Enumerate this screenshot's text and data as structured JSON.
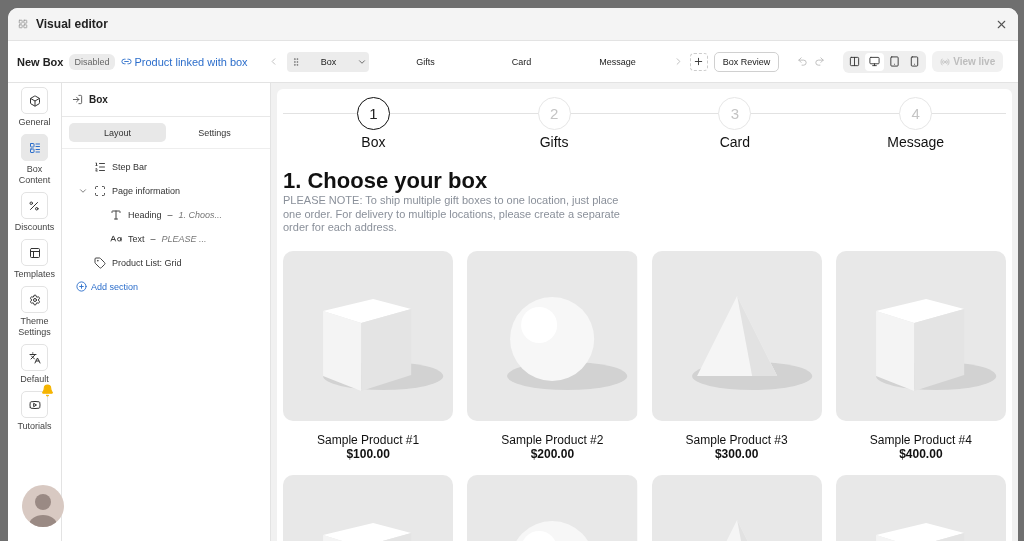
{
  "window": {
    "title": "Visual editor"
  },
  "toolbar": {
    "box_name": "New Box",
    "status": "Disabled",
    "link": "Product linked with box",
    "steps": [
      {
        "label": "Box",
        "selected": true
      },
      {
        "label": "Gifts",
        "selected": false
      },
      {
        "label": "Card",
        "selected": false
      },
      {
        "label": "Message",
        "selected": false
      }
    ],
    "review_button": "Box Review",
    "devices": [
      {
        "kind": "fullwidth",
        "selected": false
      },
      {
        "kind": "desktop",
        "selected": true
      },
      {
        "kind": "tablet",
        "selected": false
      },
      {
        "kind": "mobile",
        "selected": false
      }
    ],
    "view_live": {
      "label": "View live",
      "disabled": true
    }
  },
  "rail": [
    {
      "label": "General",
      "kind": "cube",
      "selected": false,
      "badge": false
    },
    {
      "label": "Box Content",
      "kind": "content",
      "selected": true,
      "badge": false
    },
    {
      "label": "Discounts",
      "kind": "discount",
      "selected": false,
      "badge": false
    },
    {
      "label": "Templates",
      "kind": "template",
      "selected": false,
      "badge": false
    },
    {
      "label": "Theme Settings",
      "kind": "gear",
      "selected": false,
      "badge": false
    },
    {
      "label": "Default",
      "kind": "translate",
      "selected": false,
      "badge": false
    },
    {
      "label": "Tutorials",
      "kind": "video",
      "selected": false,
      "badge": true
    }
  ],
  "panel": {
    "title": "Box",
    "tabs": [
      {
        "label": "Layout",
        "selected": true
      },
      {
        "label": "Settings",
        "selected": false
      }
    ],
    "tree": [
      {
        "label": "Step Bar",
        "kind": "list"
      },
      {
        "label": "Page information",
        "kind": "frame",
        "expanded": true,
        "children": [
          {
            "label": "Heading",
            "kind": "heading",
            "separator": "–",
            "detail": "1. Choos..."
          },
          {
            "label": "Text",
            "kind": "text",
            "separator": "–",
            "detail": "PLEASE ..."
          }
        ]
      },
      {
        "label": "Product List: Grid",
        "kind": "tag"
      }
    ],
    "add_section": "Add section"
  },
  "preview": {
    "stepper": [
      {
        "number": "1",
        "label": "Box",
        "selected": true
      },
      {
        "number": "2",
        "label": "Gifts",
        "selected": false
      },
      {
        "number": "3",
        "label": "Card",
        "selected": false
      },
      {
        "number": "4",
        "label": "Message",
        "selected": false
      }
    ],
    "heading": "1. Choose your box",
    "note": "PLEASE NOTE: To ship multiple gift boxes to one location, just place one order. For delivery to multiple locations, please create a separate order for each address.",
    "products": [
      {
        "name": "Sample Product #1",
        "price": "$100.00",
        "kind": "picture"
      },
      {
        "name": "Sample Product #2",
        "price": "$200.00",
        "kind": "picture"
      },
      {
        "name": "Sample Product #3",
        "price": "$300.00",
        "kind": "picture"
      },
      {
        "name": "Sample Product #4",
        "price": "$400.00",
        "kind": "picture"
      },
      {
        "kind": "picture"
      },
      {
        "kind": "picture"
      },
      {
        "kind": "picture"
      },
      {
        "kind": "picture"
      }
    ]
  }
}
